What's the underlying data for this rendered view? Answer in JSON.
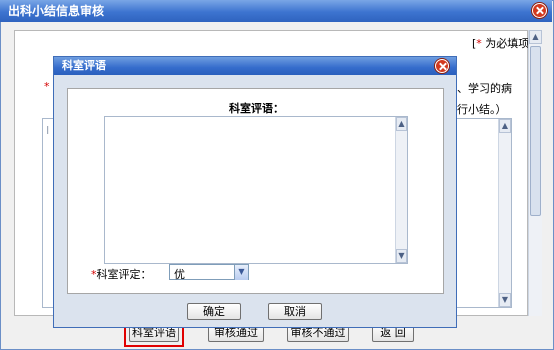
{
  "window": {
    "title": "出科小结信息审核",
    "required_star": "*",
    "required_text": " 为必填项",
    "bracket_open": "[",
    "bracket_close": "]",
    "bg_text_line1": "、学习的病",
    "bg_text_line2": "行小结。）",
    "bg_star": "*",
    "bg_label_fragment": "I"
  },
  "modal": {
    "title": "科室评语",
    "comment_label": "科室评语：",
    "comment_value": "",
    "rating_star": "*",
    "rating_label": "科室评定：",
    "rating_selected": "优",
    "confirm_button": "确定",
    "cancel_button": "取消"
  },
  "bottom_buttons": [
    {
      "label": "科室评语"
    },
    {
      "label": "审核通过"
    },
    {
      "label": "审核不通过"
    },
    {
      "label": "返 回"
    }
  ],
  "colors": {
    "titlebar": "#3d74d0",
    "highlight": "#e00000",
    "required": "#d40000"
  }
}
